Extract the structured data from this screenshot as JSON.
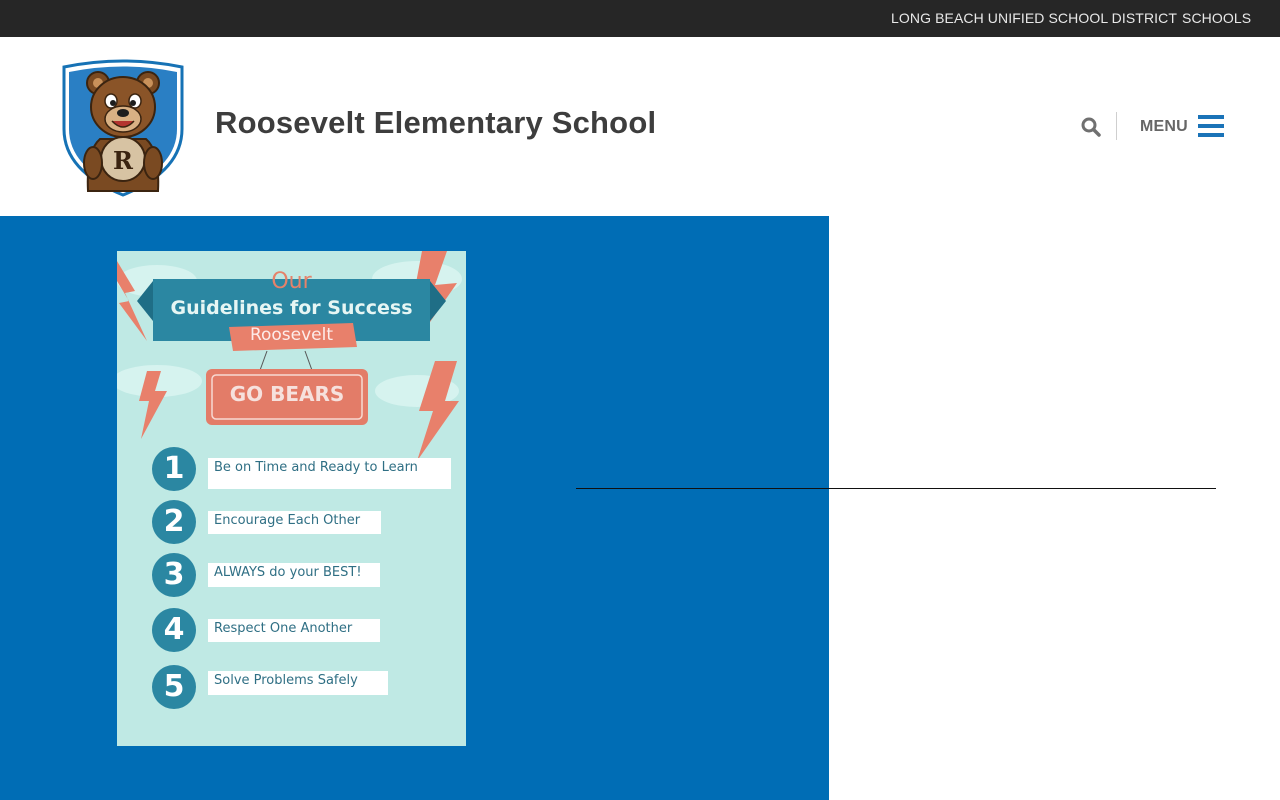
{
  "topbar": {
    "district_link": "LONG BEACH UNIFIED SCHOOL DISTRICT",
    "schools_link": "SCHOOLS"
  },
  "header": {
    "school_name": "Roosevelt Elementary School",
    "logo_letter": "R",
    "menu_label": "MENU"
  },
  "poster": {
    "our": "Our",
    "title": "Guidelines for Success",
    "school": "Roosevelt",
    "sign": "GO BEARS",
    "guidelines": [
      {
        "number": "1",
        "text": "Be on Time and Ready to Learn"
      },
      {
        "number": "2",
        "text": "Encourage Each Other"
      },
      {
        "number": "3",
        "text": "ALWAYS do your BEST!"
      },
      {
        "number": "4",
        "text": "Respect One Another"
      },
      {
        "number": "5",
        "text": "Solve Problems Safely"
      }
    ]
  },
  "colors": {
    "topbar_bg": "#262626",
    "brand_blue": "#006db5",
    "menu_icon": "#1a73b8",
    "poster_bg": "#bfe9e4",
    "poster_teal": "#2b87a2",
    "poster_coral": "#e8806b"
  },
  "icons": {
    "search": "search-icon",
    "menu": "hamburger-menu-icon",
    "logo": "bear-mascot-shield-logo"
  }
}
